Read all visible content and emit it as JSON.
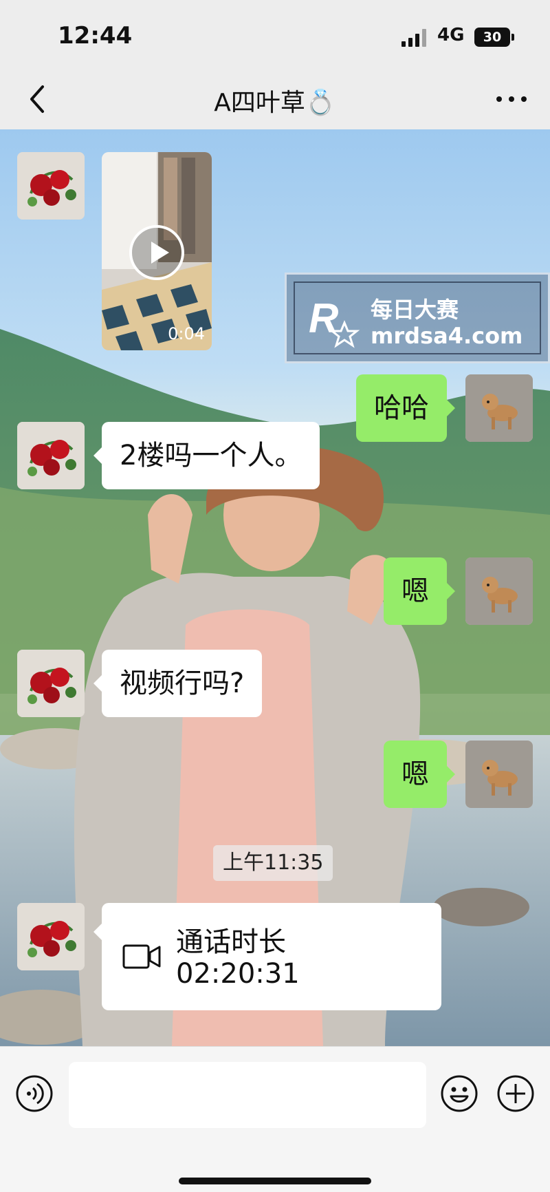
{
  "status_bar": {
    "time": "12:44",
    "network": "4G",
    "battery": "30"
  },
  "header": {
    "title": "A四叶草💍"
  },
  "messages": [
    {
      "type": "video",
      "side": "left",
      "duration": "0:04"
    },
    {
      "type": "text",
      "side": "right",
      "text": "哈哈"
    },
    {
      "type": "text",
      "side": "left",
      "text": "2楼吗一个人。"
    },
    {
      "type": "text",
      "side": "right",
      "text": "嗯"
    },
    {
      "type": "text",
      "side": "left",
      "text": "视频行吗?"
    },
    {
      "type": "text",
      "side": "right",
      "text": "嗯"
    }
  ],
  "timestamp": "上午11:35",
  "call": {
    "label": "通话时长",
    "duration": "02:20:31"
  },
  "watermark": {
    "title": "每日大赛",
    "url": "mrdsa4.com",
    "logo_text": "每日大赛"
  },
  "icons": {
    "back": "chevron-left-icon",
    "more": "more-icon",
    "voice": "voice-icon",
    "emoji": "emoji-icon",
    "plus": "plus-icon",
    "video_call": "video-camera-icon"
  },
  "colors": {
    "sent_bubble": "#95ec69",
    "received_bubble": "#ffffff",
    "background": "#ededed"
  }
}
